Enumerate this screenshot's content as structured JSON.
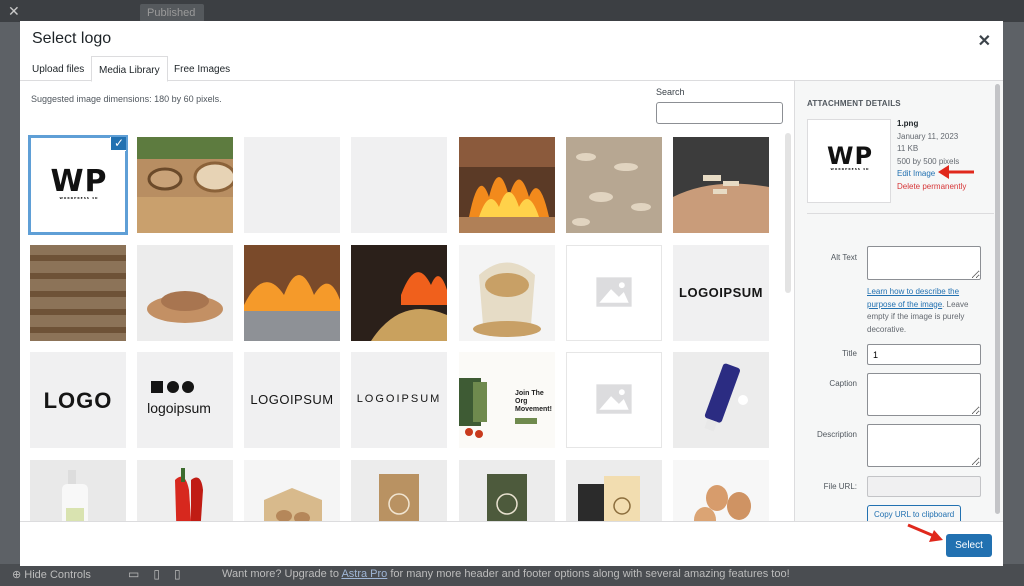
{
  "background": {
    "top_button": "Published",
    "close_glyph": "✕",
    "hide_controls": "⊕ Hide Controls",
    "devices": "▭▯▯",
    "promo_prefix": "Want more? Upgrade to ",
    "promo_link": "Astra Pro",
    "promo_suffix": " for many more header and footer options along with several amazing features too!"
  },
  "modal": {
    "title": "Select logo",
    "close_glyph": "✕",
    "tabs": [
      {
        "label": "Upload files"
      },
      {
        "label": "Media Library"
      },
      {
        "label": "Free Images"
      }
    ],
    "suggestion": "Suggested image dimensions: 180 by 60 pixels.",
    "search_label": "Search",
    "search_value": "",
    "check_glyph": "✓"
  },
  "thumb_logos": {
    "wp": "WP",
    "wp_sub": "WORDPRESS 4D",
    "logoipsum_block": "LOGO",
    "logoipsum_circles": "logoipsum",
    "logoipsum_hat": "LOGOIPSUM",
    "logoipsum_wave": "LOGOIPSUM",
    "logoipsum_bold": "LOGOIPSUM",
    "movement_text": "Join The Org Movement!"
  },
  "attachment": {
    "heading": "ATTACHMENT DETAILS",
    "filename": "1.png",
    "date": "January 11, 2023",
    "size": "11 KB",
    "dimensions": "500 by 500 pixels",
    "edit_link": "Edit Image",
    "delete_link": "Delete permanently",
    "alt_label": "Alt Text",
    "alt_value": "",
    "help_link": "Learn how to describe the purpose of the image",
    "help_suffix": ". Leave empty if the image is purely decorative.",
    "title_label": "Title",
    "title_value": "1",
    "caption_label": "Caption",
    "caption_value": "",
    "description_label": "Description",
    "description_value": "",
    "url_label": "File URL:",
    "url_value": "",
    "copy_button": "Copy URL to clipboard"
  },
  "footer": {
    "select_button": "Select"
  },
  "colors": {
    "accent": "#2271b1",
    "delete": "#d63638",
    "arrow": "#e0281c"
  }
}
